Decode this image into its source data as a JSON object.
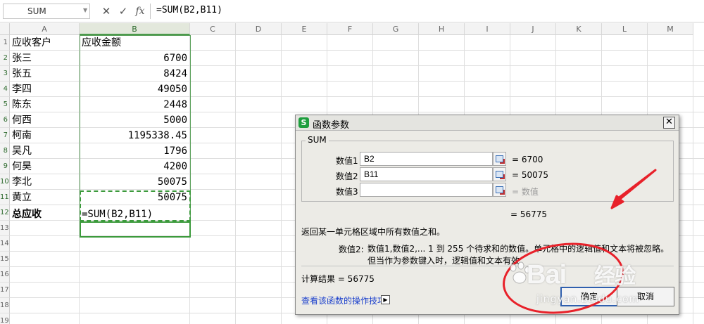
{
  "formula_bar": {
    "name_box": "SUM",
    "cancel_symbol": "✕",
    "enter_symbol": "✓",
    "fx_label": "fx",
    "formula": "=SUM(B2,B11)"
  },
  "columns": [
    "A",
    "B",
    "C",
    "D",
    "E",
    "F",
    "G",
    "H",
    "I",
    "J",
    "K",
    "L",
    "M"
  ],
  "row_numbers": [
    "1",
    "2",
    "3",
    "4",
    "5",
    "6",
    "7",
    "8",
    "9",
    "10",
    "11",
    "12",
    "13",
    "14",
    "15",
    "16",
    "17",
    "18",
    "19"
  ],
  "sheet": {
    "header": {
      "a": "应收客户",
      "b": "应收金额"
    },
    "rows": [
      {
        "a": "张三",
        "b": "6700"
      },
      {
        "a": "张五",
        "b": "8424"
      },
      {
        "a": "李四",
        "b": "49050"
      },
      {
        "a": "陈东",
        "b": "2448"
      },
      {
        "a": "何西",
        "b": "5000"
      },
      {
        "a": "柯南",
        "b": "1195338.45"
      },
      {
        "a": "吴凡",
        "b": "1796"
      },
      {
        "a": "何昊",
        "b": "4200"
      },
      {
        "a": "李北",
        "b": "50075"
      },
      {
        "a": "黄立",
        "b": "50075"
      }
    ],
    "total": {
      "a": "总应收",
      "b": "=SUM(B2,B11)"
    }
  },
  "dialog": {
    "title": "函数参数",
    "logo": "S",
    "close": "✕",
    "group": "SUM",
    "args": [
      {
        "label": "数值1",
        "input": "B2",
        "value": "= 6700"
      },
      {
        "label": "数值2",
        "input": "B11",
        "value": "= 50075"
      },
      {
        "label": "数值3",
        "input": "",
        "value": "= 数值"
      }
    ],
    "total": "= 56775",
    "description": "返回某一单元格区域中所有数值之和。",
    "param_name": "数值2:",
    "param_desc": "数值1,数值2,... 1 到 255 个待求和的数值。单元格中的逻辑值和文本将被忽略。但当作为参数键入时，逻辑值和文本有效",
    "calc_result": "计算结果 =  56775",
    "help_link": "查看该函数的操作技巧",
    "ok": "确定",
    "cancel": "取消"
  },
  "watermark": {
    "logo": "Bai",
    "logo2": "经验",
    "url": "jingyan.baidu.com"
  },
  "colors": {
    "accent_green": "#3c9a3c",
    "annotation_red": "#e8212a",
    "link_blue": "#1a3fcc"
  }
}
